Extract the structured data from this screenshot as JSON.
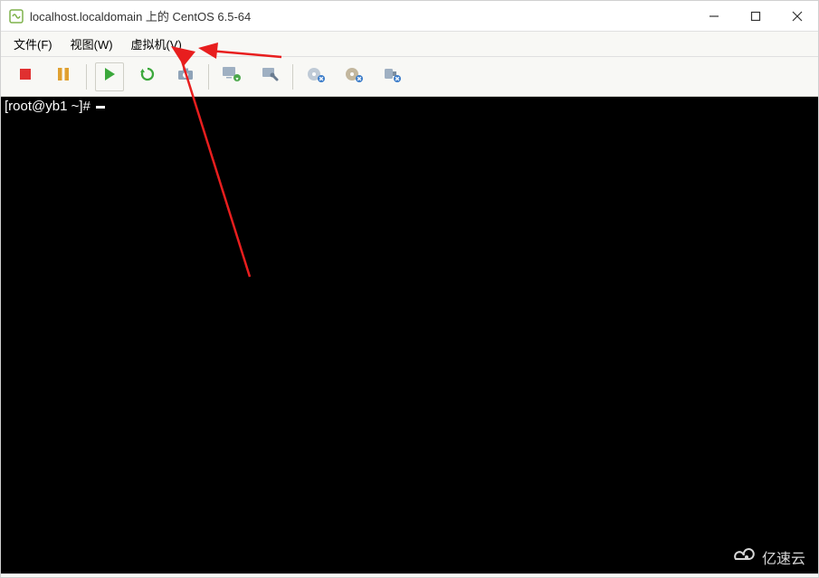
{
  "title": "localhost.localdomain 上的 CentOS 6.5-64",
  "menus": {
    "file": "文件(F)",
    "view": "视图(W)",
    "vm": "虚拟机(V)"
  },
  "toolbar": {
    "stop": "stop",
    "pause": "pause",
    "play": "play",
    "refresh": "refresh",
    "connect": "connect",
    "capture": "capture",
    "tools": "tools",
    "cdrom": "cdrom",
    "floppy": "floppy",
    "usb": "usb"
  },
  "terminal_prompt": "[root@yb1 ~]# ",
  "watermark": "亿速云"
}
